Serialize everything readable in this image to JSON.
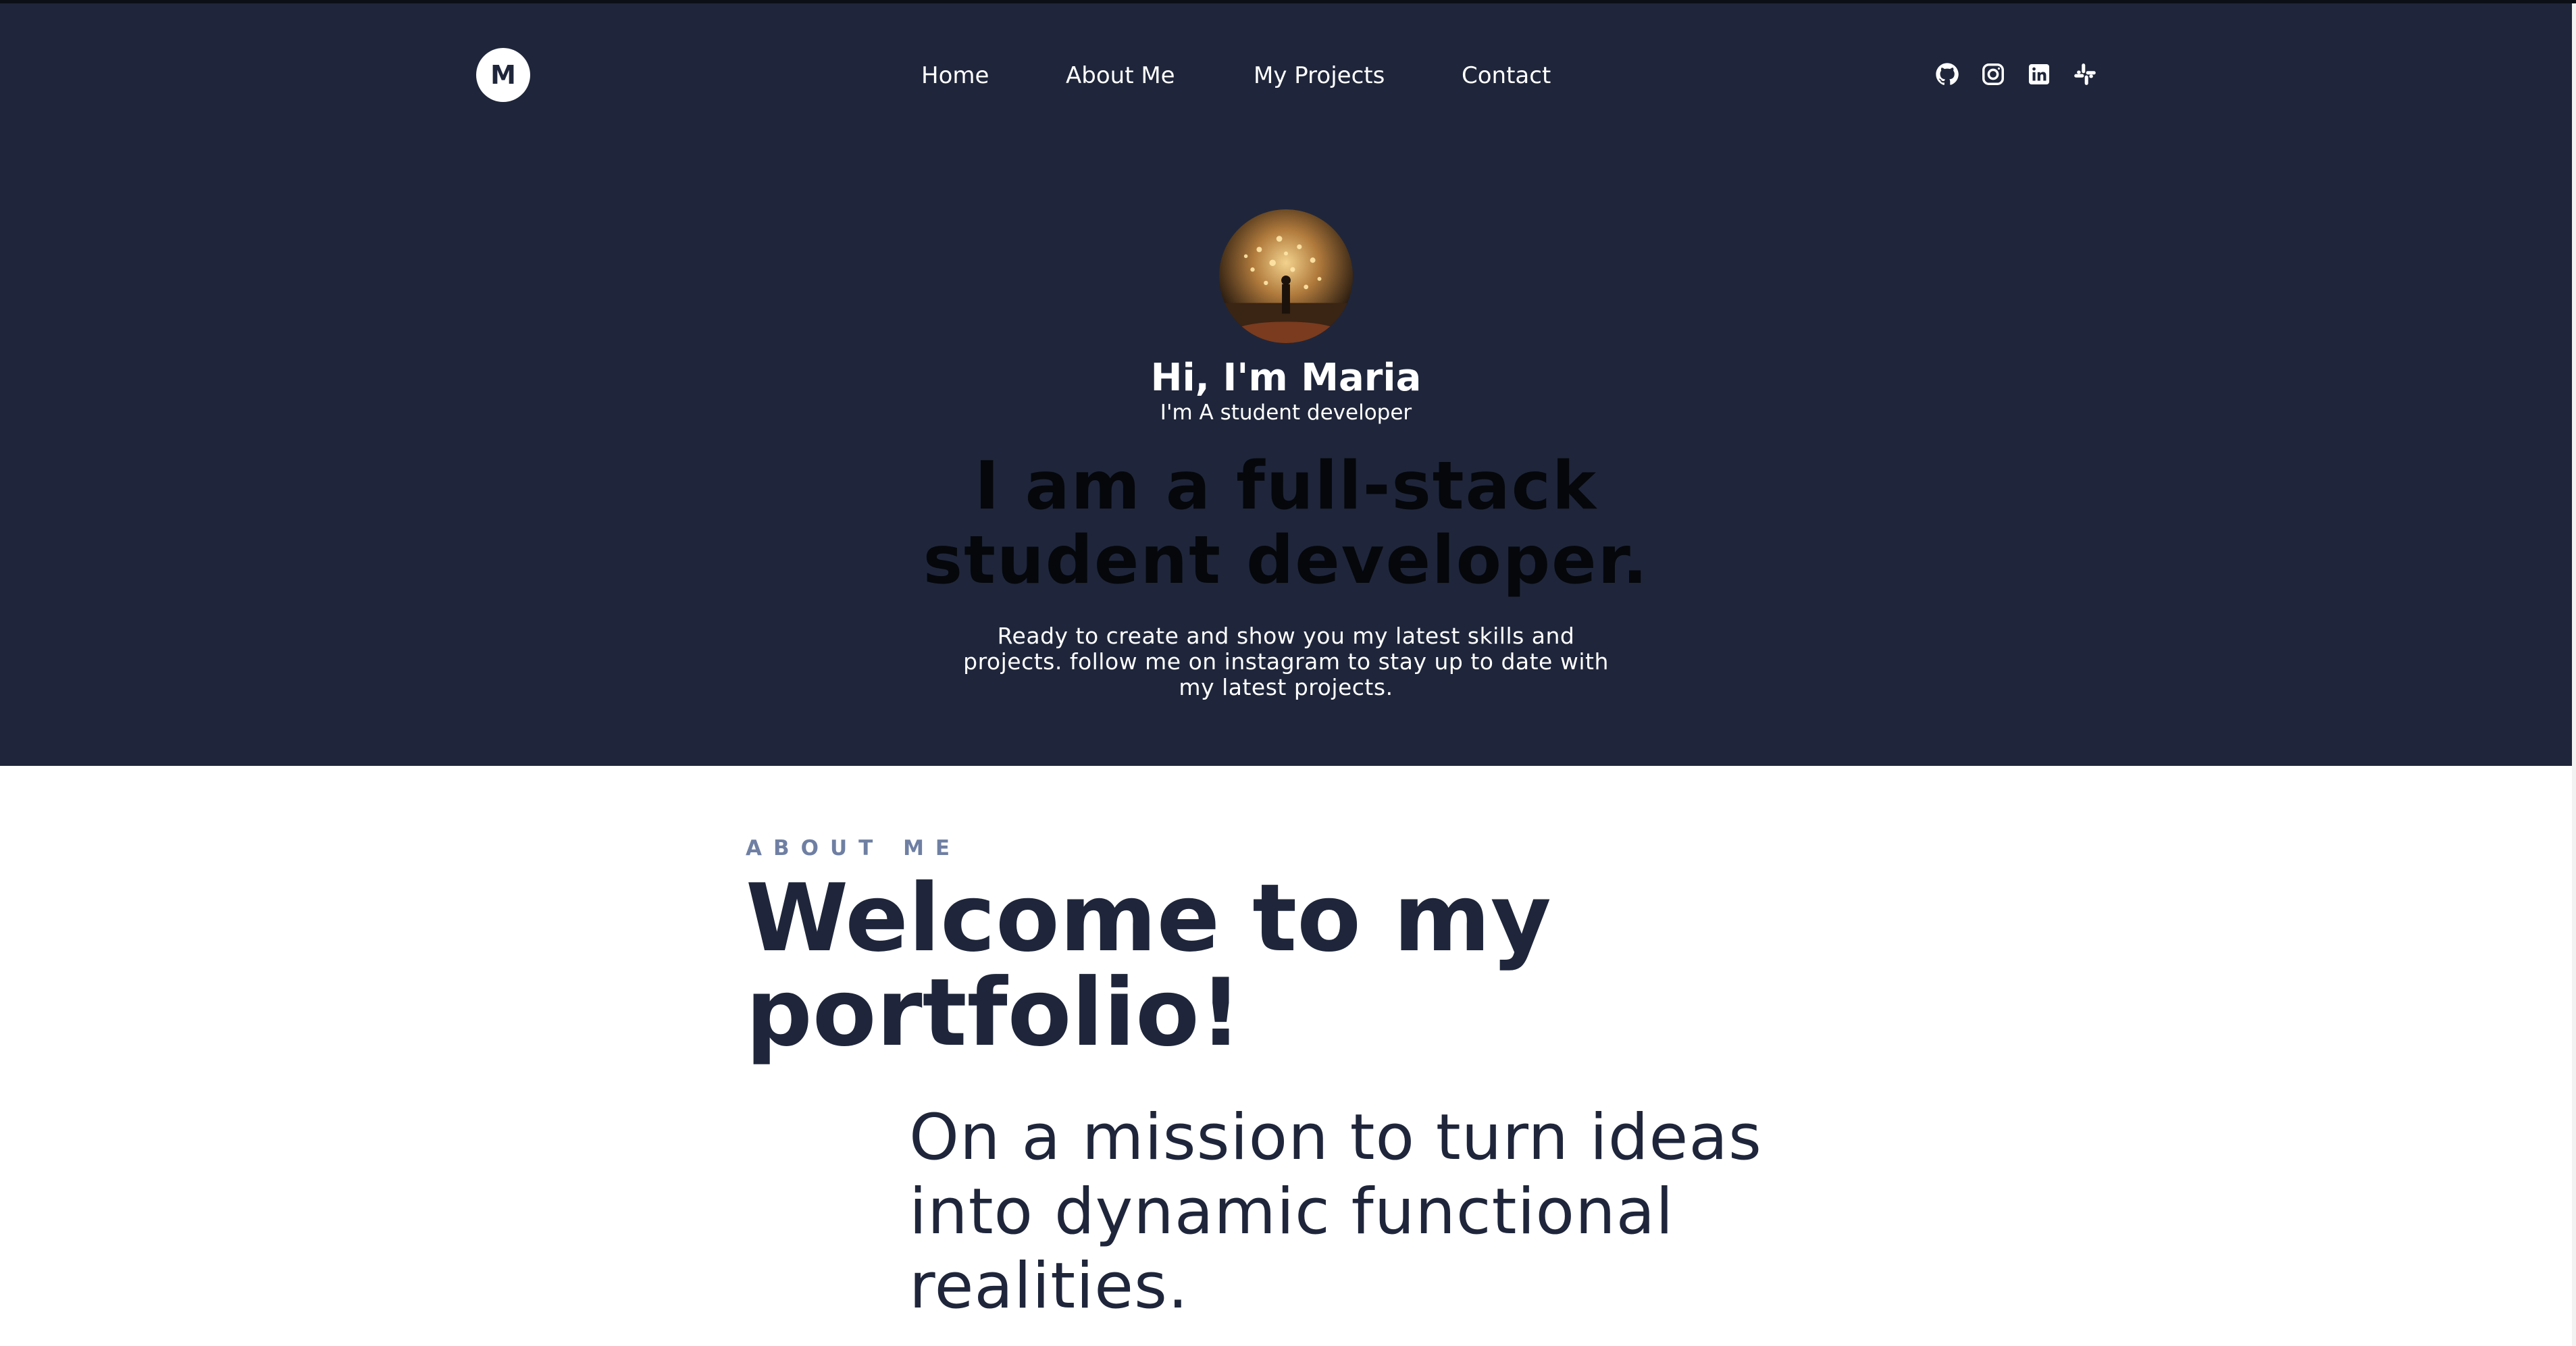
{
  "header": {
    "logo_letter": "M",
    "nav": [
      {
        "label": "Home"
      },
      {
        "label": "About Me"
      },
      {
        "label": "My Projects"
      },
      {
        "label": "Contact"
      }
    ],
    "social_icons": [
      "github-icon",
      "instagram-icon",
      "linkedin-icon",
      "slack-icon"
    ]
  },
  "hero": {
    "greeting": "Hi, I'm Maria",
    "subtitle": "I'm A student developer",
    "headline": "I am a full-stack student developer.",
    "intro": "Ready to create and show you my latest skills and projects. follow me on instagram to stay up to date with my latest projects."
  },
  "about": {
    "eyebrow": "ABOUT ME",
    "title": "Welcome to my portfolio!",
    "mission": "On a mission to turn ideas into dynamic functional realities."
  },
  "colors": {
    "hero_bg": "#1f263b",
    "headline": "#05070b",
    "eyebrow": "#6f7fa3",
    "text_dark": "#1f263b"
  }
}
